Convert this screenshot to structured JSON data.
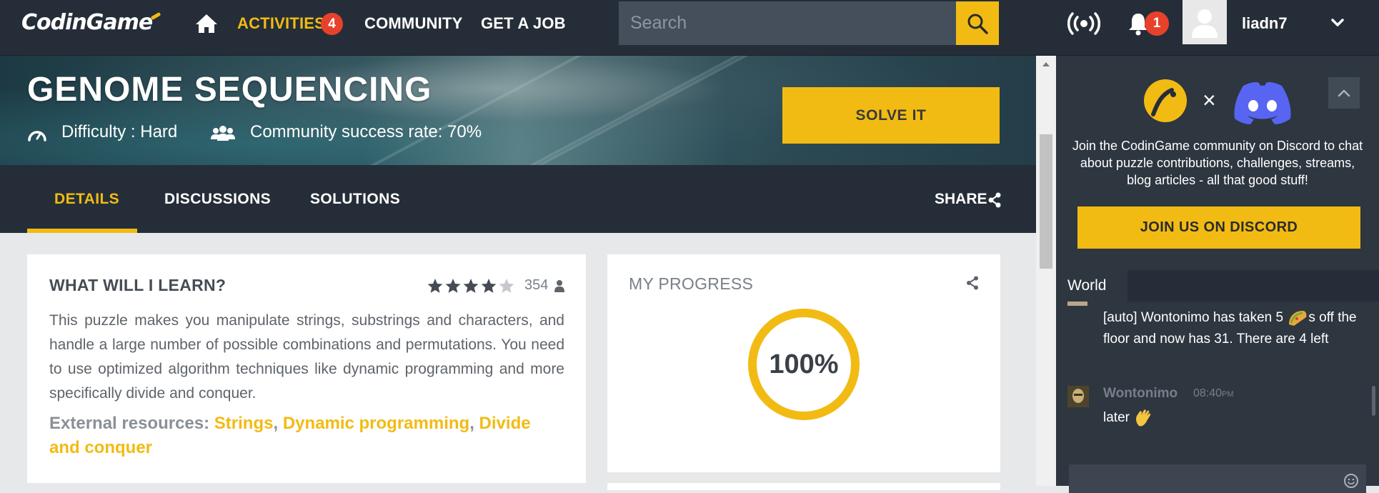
{
  "nav": {
    "logo": "CodinGame",
    "activities_label": "ACTIVITIES",
    "activities_count": "4",
    "community_label": "COMMUNITY",
    "job_label": "GET A JOB",
    "search_placeholder": "Search",
    "notifications_count": "1",
    "username": "liadn7"
  },
  "puzzle": {
    "title": "GENOME SEQUENCING",
    "difficulty": "Difficulty : Hard",
    "success_rate": "Community success rate: 70%",
    "solve_label": "SOLVE IT"
  },
  "tabs": {
    "details": "DETAILS",
    "discussions": "DISCUSSIONS",
    "solutions": "SOLUTIONS",
    "share": "SHARE"
  },
  "learn": {
    "title": "WHAT WILL I LEARN?",
    "rating_stars": 4,
    "rating_max": 5,
    "rating_count": "354",
    "description": "This puzzle makes you manipulate strings, substrings and characters, and handle a large number of possible combinations and permutations. You need to use optimized algorithm techniques like dynamic programming and more specifically divide and conquer.",
    "resources_label": "External resources:",
    "resources": [
      "Strings",
      "Dynamic programming",
      "Divide and conquer"
    ],
    "separator": ","
  },
  "progress": {
    "title": "MY PROGRESS",
    "value_text": "100%",
    "value": 100
  },
  "promo": {
    "times": "×",
    "text": "Join the CodinGame community on Discord to chat about puzzle contributions, challenges, streams, blog articles - all that good stuff!",
    "button": "JOIN US ON DISCORD"
  },
  "chat": {
    "tab": "World",
    "auto_part1": "[auto] Wontonimo has taken 5",
    "auto_part2": "s off the floor and now has 31.  There are 4 left",
    "user": "Wontonimo",
    "time": "08:40",
    "time_suffix": "PM",
    "message": "later"
  },
  "colors": {
    "accent": "#f2bb13",
    "nav_bg": "#252e38",
    "badge_red": "#e7412c",
    "discord_blue": "#5865f2"
  },
  "icons": [
    "home-icon",
    "search-icon",
    "broadcast-icon",
    "bell-icon",
    "chevron-down-icon",
    "gauge-icon",
    "users-icon",
    "share-icon",
    "star-icon",
    "person-icon",
    "codingame-logo",
    "discord-logo",
    "chevron-up-icon",
    "emoji-icon"
  ]
}
